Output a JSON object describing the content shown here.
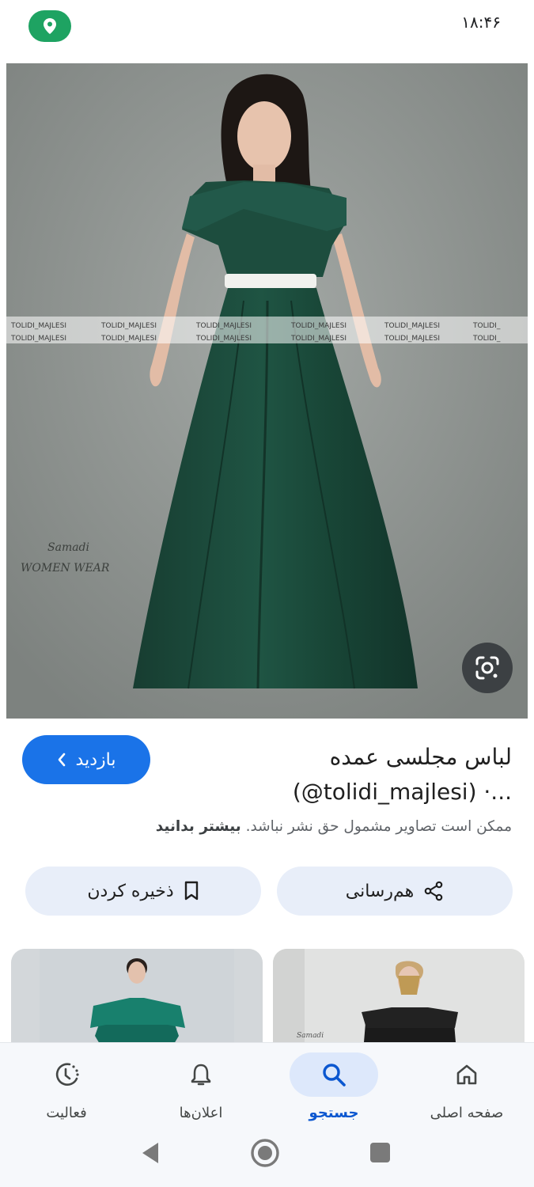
{
  "status_bar": {
    "time": "۱۸:۴۶",
    "location_icon": "location-pin-icon",
    "location_pill_color": "#1ea362"
  },
  "image": {
    "watermark_text": "TOLIDI_MAJLESI",
    "signature_text": "Samadi WOMEN WEAR",
    "dress_color": "#1a4a3a"
  },
  "lens_icon": "google-lens-icon",
  "result": {
    "title_line1": "لباس مجلسی عمده",
    "title_line2": "(@tolidi_majlesi) ·...",
    "visit_label": "بازدید",
    "copyright_text": "ممکن است تصاویر مشمول حق نشر نباشد.",
    "learn_more": "بیشتر بدانید"
  },
  "actions": {
    "share_label": "هم‌رسانی",
    "save_label": "ذخیره کردن"
  },
  "bottom_nav": {
    "items": [
      {
        "label": "صفحه اصلی",
        "icon": "home-icon",
        "active": false
      },
      {
        "label": "جستجو",
        "icon": "search-icon",
        "active": true
      },
      {
        "label": "اعلان‌ها",
        "icon": "bell-icon",
        "active": false
      },
      {
        "label": "فعالیت",
        "icon": "activity-icon",
        "active": false
      }
    ]
  },
  "colors": {
    "accent": "#1a73e8",
    "active_nav": "#0b57d0",
    "action_bg": "#e8eef9"
  }
}
